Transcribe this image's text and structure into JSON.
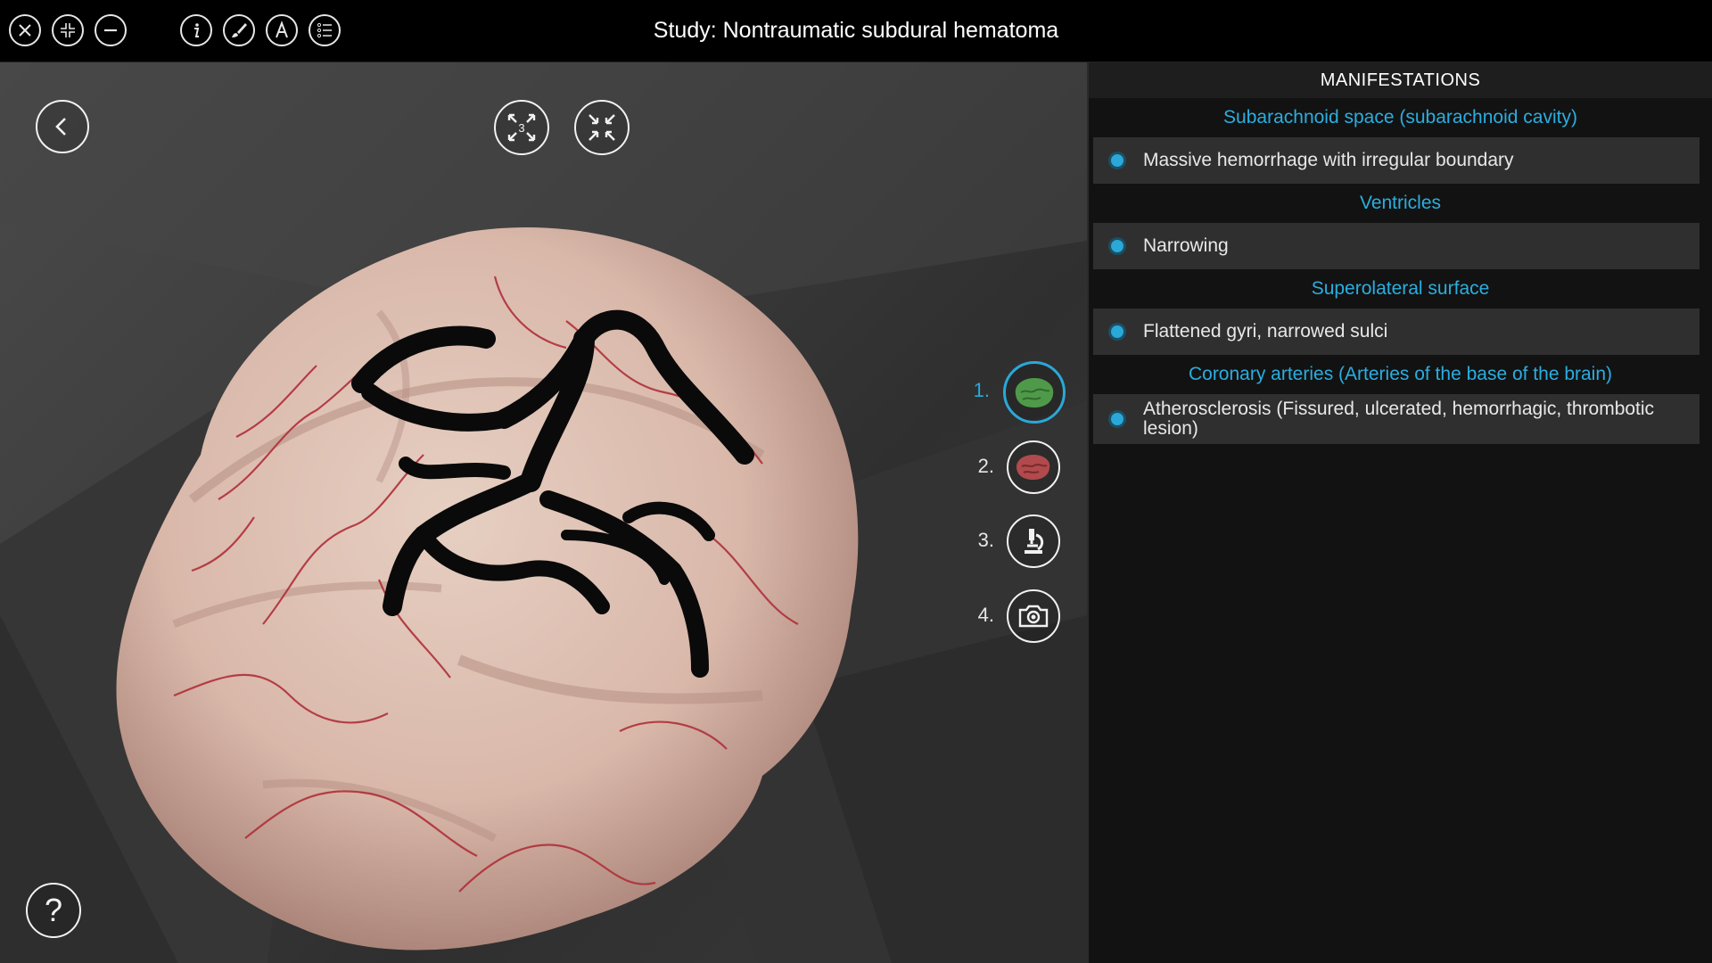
{
  "window": {
    "title": "Study: Nontraumatic subdural hematoma"
  },
  "toolbar": {
    "left_icons": [
      "close-icon",
      "collapse-icon",
      "minimize-icon"
    ],
    "tool_icons": [
      "info-icon",
      "brush-icon",
      "text-icon",
      "list-icon"
    ]
  },
  "viewport": {
    "view_buttons": [
      {
        "icon": "expand-3-icon",
        "label": "3"
      },
      {
        "icon": "shrink-icon"
      }
    ],
    "steps": [
      {
        "num": "1.",
        "icon": "brain-green-icon",
        "active": true
      },
      {
        "num": "2.",
        "icon": "brain-red-icon",
        "active": false
      },
      {
        "num": "3.",
        "icon": "microscope-icon",
        "active": false
      },
      {
        "num": "4.",
        "icon": "camera-icon",
        "active": false
      }
    ],
    "help_label": "?"
  },
  "panel": {
    "header": "MANIFESTATIONS",
    "sections": [
      {
        "title": "Subarachnoid space (subarachnoid cavity)",
        "items": [
          "Massive hemorrhage with irregular boundary"
        ]
      },
      {
        "title": "Ventricles",
        "items": [
          "Narrowing"
        ]
      },
      {
        "title": "Superolateral surface",
        "items": [
          "Flattened gyri, narrowed sulci"
        ]
      },
      {
        "title": "Coronary arteries (Arteries of the base of the brain)",
        "items": [
          "Atherosclerosis (Fissured, ulcerated, hemorrhagic, thrombotic lesion)"
        ]
      }
    ]
  },
  "colors": {
    "accent": "#2aa8d8",
    "panel_bg": "#121212",
    "item_bg": "#2f2f2f",
    "topbar_bg": "#000000"
  }
}
